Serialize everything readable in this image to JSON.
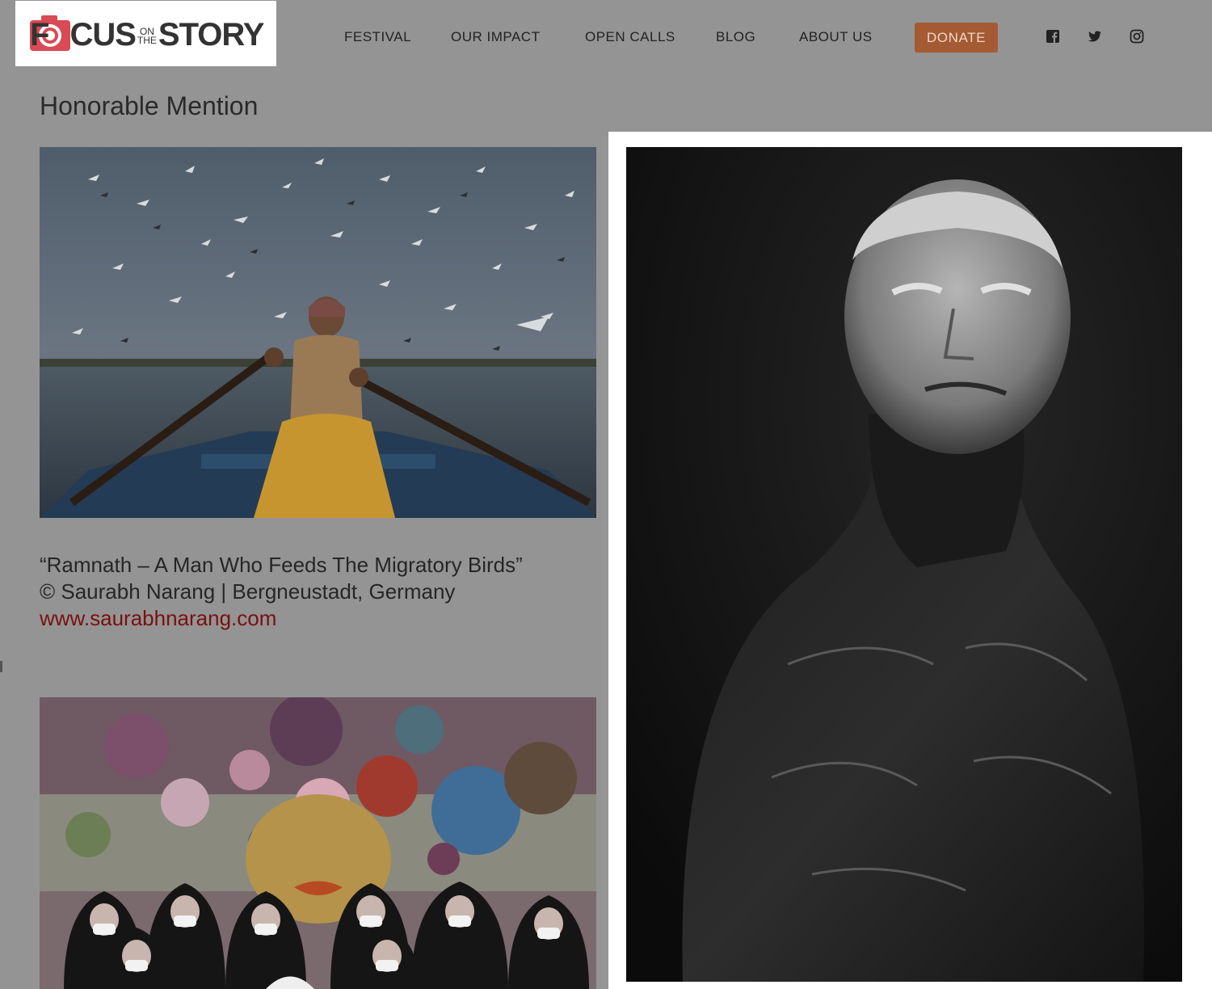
{
  "brand": {
    "part1": "F",
    "part2": "CUS",
    "small_top": "ON",
    "small_bottom": "THE",
    "part3": "STORY"
  },
  "nav": {
    "items": [
      "FESTIVAL",
      "OUR IMPACT",
      "OPEN CALLS",
      "BLOG",
      "ABOUT US"
    ],
    "donate_label": "DONATE"
  },
  "social": [
    "facebook-icon",
    "twitter-icon",
    "instagram-icon"
  ],
  "page": {
    "title": "Honorable Mention"
  },
  "entry": {
    "title": "“Ramnath – A Man Who Feeds The Migratory Birds”",
    "credit": "© Saurabh Narang | Bergneustadt, Germany",
    "link": "www.saurabhnarang.com"
  },
  "colors": {
    "overlay_bg": "#949494",
    "donate_bg": "#a45a33",
    "link": "#7a1010"
  }
}
